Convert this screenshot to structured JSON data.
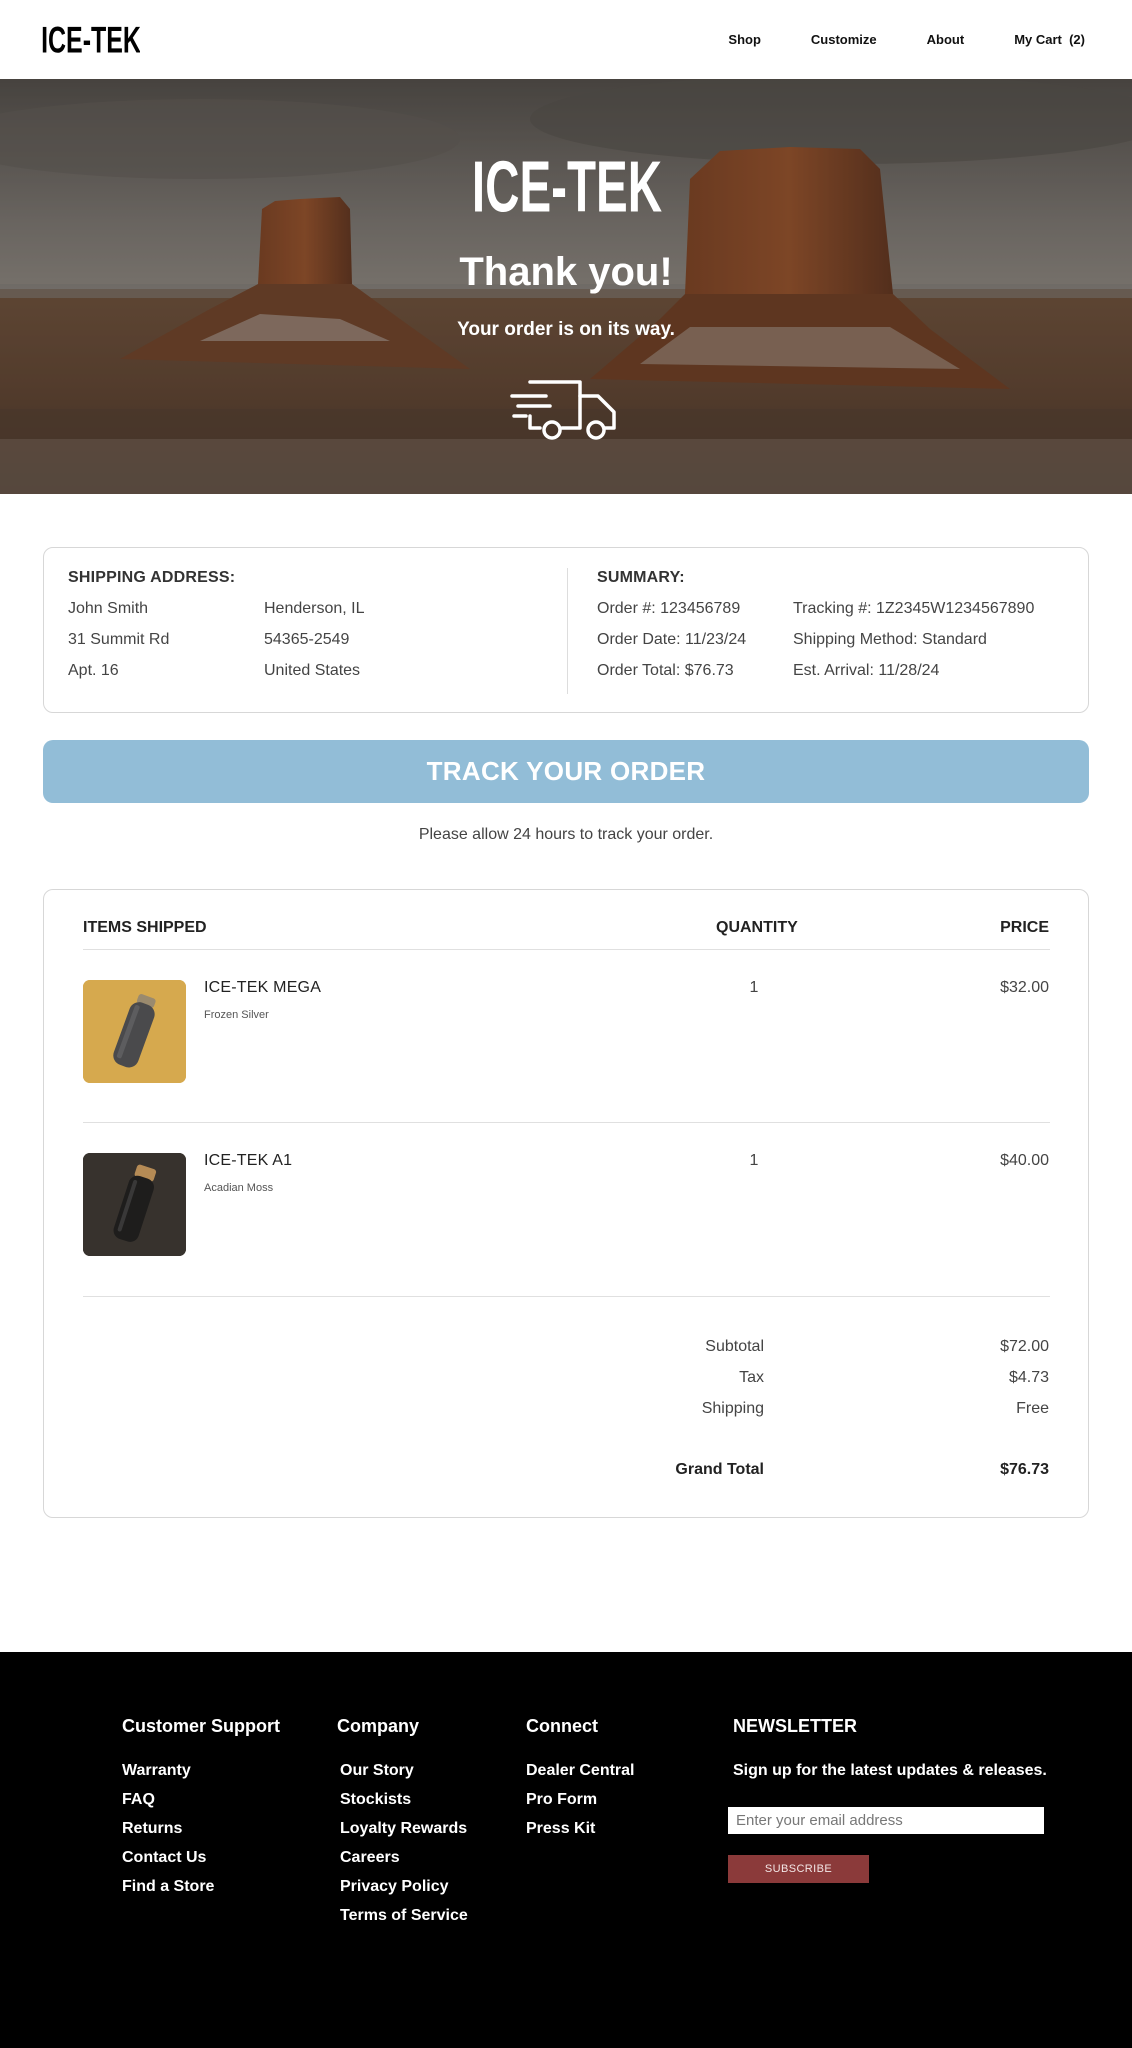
{
  "brand": {
    "logo_text": "ICE-TEK"
  },
  "nav": {
    "shop": "Shop",
    "customize": "Customize",
    "about": "About",
    "cart": "My Cart  (2)"
  },
  "hero": {
    "logo_text": "ICE-TEK",
    "title": "Thank you!",
    "subtitle": "Your order is on its way."
  },
  "shipping": {
    "heading": "SHIPPING ADDRESS:",
    "name": "John Smith",
    "street": "31 Summit Rd",
    "apt": "Apt. 16",
    "city": "Henderson, IL",
    "zip": "54365-2549",
    "country": "United States"
  },
  "summary": {
    "heading": "SUMMARY:",
    "order_no": "Order #: 123456789",
    "order_date": "Order Date: 11/23/24",
    "order_total": "Order Total: $76.73",
    "tracking": "Tracking #: 1Z2345W1234567890",
    "shipping_method": "Shipping Method: Standard",
    "est_arrival": "Est. Arrival: 11/28/24"
  },
  "track": {
    "button_label": "TRACK YOUR ORDER",
    "note": "Please allow 24 hours to track your order."
  },
  "items": {
    "headers": {
      "items": "ITEMS SHIPPED",
      "quantity": "QUANTITY",
      "price": "PRICE"
    },
    "rows": [
      {
        "name": "ICE-TEK MEGA",
        "variant": "Frozen Silver",
        "quantity": "1",
        "price": "$32.00",
        "thumb_bg": "#d9ad52"
      },
      {
        "name": "ICE-TEK A1",
        "variant": "Acadian Moss",
        "quantity": "1",
        "price": "$40.00",
        "thumb_bg": "#3a342e"
      }
    ],
    "totals": {
      "subtotal_label": "Subtotal",
      "subtotal": "$72.00",
      "tax_label": "Tax",
      "tax": "$4.73",
      "shipping_label": "Shipping",
      "shipping": "Free",
      "grand_label": "Grand Total",
      "grand": "$76.73"
    }
  },
  "footer": {
    "support": {
      "heading": "Customer Support",
      "links": [
        "Warranty",
        "FAQ",
        "Returns",
        "Contact Us",
        "Find a Store"
      ]
    },
    "company": {
      "heading": "Company",
      "links": [
        "Our Story",
        "Stockists",
        "Loyalty Rewards",
        "Careers",
        "Privacy Policy",
        "Terms of Service"
      ]
    },
    "connect": {
      "heading": "Connect",
      "links": [
        "Dealer Central",
        "Pro Form",
        "Press Kit"
      ]
    },
    "newsletter": {
      "heading": "NEWSLETTER",
      "text": "Sign up for the latest updates & releases.",
      "placeholder": "Enter your email address",
      "button": "SUBSCRIBE"
    }
  },
  "colors": {
    "track_button": "#92bdd7",
    "subscribe_button": "#8b3a3a",
    "footer_bg": "#000000"
  }
}
